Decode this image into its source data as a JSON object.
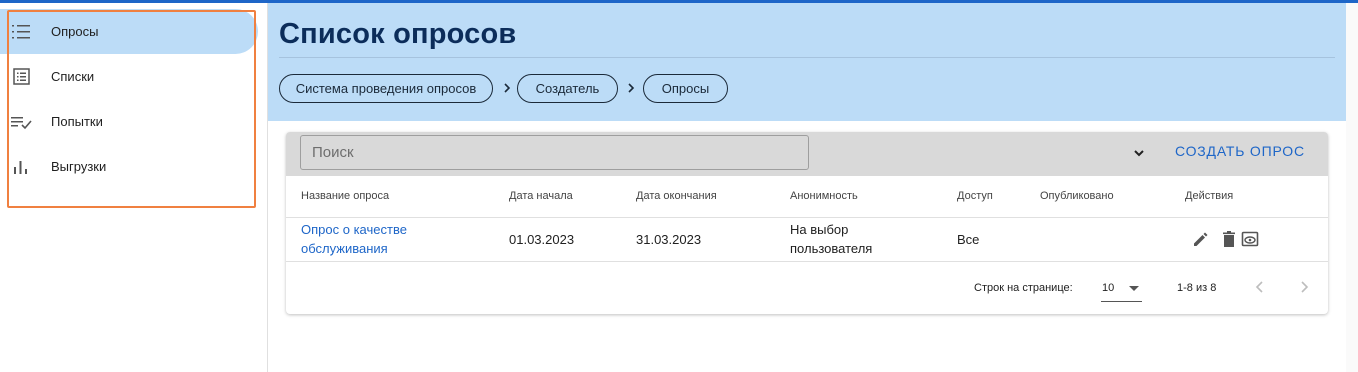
{
  "sidebar": {
    "items": [
      {
        "label": "Опросы",
        "icon": "list-numbered-icon",
        "active": true
      },
      {
        "label": "Списки",
        "icon": "list-box-icon",
        "active": false
      },
      {
        "label": "Попытки",
        "icon": "checklist-icon",
        "active": false
      },
      {
        "label": "Выгрузки",
        "icon": "bar-chart-icon",
        "active": false
      }
    ]
  },
  "header": {
    "title": "Список опросов",
    "breadcrumbs": [
      "Система проведения опросов",
      "Создатель",
      "Опросы"
    ]
  },
  "toolbar": {
    "search_placeholder": "Поиск",
    "create_label": "СОЗДАТЬ ОПРОС"
  },
  "table": {
    "columns": [
      "Название опроса",
      "Дата начала",
      "Дата окончания",
      "Анонимность",
      "Доступ",
      "Опубликовано",
      "Действия"
    ],
    "rows": [
      {
        "name_line1": "Опрос о качестве",
        "name_line2": "обслуживания",
        "start": "01.03.2023",
        "end": "31.03.2023",
        "anon_line1": "На выбор",
        "anon_line2": "пользователя",
        "access": "Все",
        "published": ""
      }
    ]
  },
  "pagination": {
    "rows_per_page_label": "Строк на странице:",
    "rows_per_page": "10",
    "range": "1-8 из 8"
  },
  "colors": {
    "accent": "#1e66c8",
    "header_bg": "#bcdcf7",
    "title": "#0c2d5a",
    "highlight": "#f08040"
  }
}
